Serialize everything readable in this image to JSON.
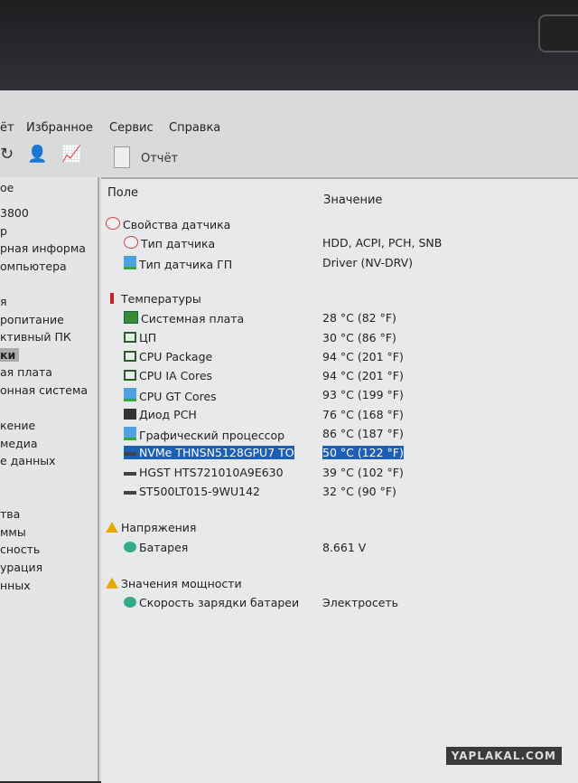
{
  "menu": [
    "ёт",
    "Избранное",
    "Сервис",
    "Справка"
  ],
  "toolbar": {
    "report_label": "Отчёт"
  },
  "left_panel": {
    "tab": "ое",
    "items": [
      "3800",
      "р",
      "рная информа",
      "омпьютера",
      "",
      "я",
      "ропитание",
      "ктивный ПК",
      "ки",
      "ая плата",
      "онная система",
      "",
      "кение",
      "медиа",
      "е данных",
      "",
      "",
      "тва",
      "ммы",
      "сность",
      "урация",
      "нных"
    ],
    "selected_index": 8
  },
  "columns": {
    "field": "Поле",
    "value": "Значение"
  },
  "rows": [
    {
      "field": "Свойства датчика",
      "value": "",
      "level": 0,
      "icon": "gauge-icon"
    },
    {
      "field": "Тип датчика",
      "value": "HDD, ACPI, PCH, SNB",
      "level": 1,
      "icon": "gauge-icon"
    },
    {
      "field": "Тип датчика ГП",
      "value": "Driver  (NV-DRV)",
      "level": 1,
      "icon": "monitor-icon"
    },
    {
      "field": "Температуры",
      "value": "",
      "level": 0,
      "icon": "thermometer-icon",
      "gap": true
    },
    {
      "field": "Системная плата",
      "value": "28 °C  (82 °F)",
      "level": 1,
      "icon": "motherboard-icon"
    },
    {
      "field": "ЦП",
      "value": "30 °C  (86 °F)",
      "level": 1,
      "icon": "cpu-icon"
    },
    {
      "field": "CPU Package",
      "value": "94 °C  (201 °F)",
      "level": 1,
      "icon": "cpu-icon"
    },
    {
      "field": "CPU IA Cores",
      "value": "94 °C  (201 °F)",
      "level": 1,
      "icon": "cpu-icon"
    },
    {
      "field": "CPU GT Cores",
      "value": "93 °C  (199 °F)",
      "level": 1,
      "icon": "monitor-icon"
    },
    {
      "field": "Диод PCH",
      "value": "76 °C  (168 °F)",
      "level": 1,
      "icon": "chip-icon"
    },
    {
      "field": "Графический процессор",
      "value": "86 °C  (187 °F)",
      "level": 1,
      "icon": "monitor-icon"
    },
    {
      "field": "NVMe THNSN5128GPU7 TO",
      "value": "50 °C  (122 °F)",
      "level": 1,
      "icon": "drive-icon",
      "selected": true
    },
    {
      "field": "HGST HTS721010A9E630",
      "value": "39 °C  (102 °F)",
      "level": 1,
      "icon": "drive-icon"
    },
    {
      "field": "ST500LT015-9WU142",
      "value": "32 °C  (90 °F)",
      "level": 1,
      "icon": "drive-icon"
    },
    {
      "field": "Напряжения",
      "value": "",
      "level": 0,
      "icon": "warning-icon",
      "gap": true
    },
    {
      "field": "Батарея",
      "value": "8.661 V",
      "level": 1,
      "icon": "battery-icon"
    },
    {
      "field": "Значения мощности",
      "value": "",
      "level": 0,
      "icon": "warning-icon",
      "gap": true
    },
    {
      "field": "Скорость зарядки батареи",
      "value": "Электросеть",
      "level": 1,
      "icon": "battery-icon"
    }
  ],
  "selection_color": "#1d5fb7",
  "watermark": "YAPLAKAL.COM"
}
